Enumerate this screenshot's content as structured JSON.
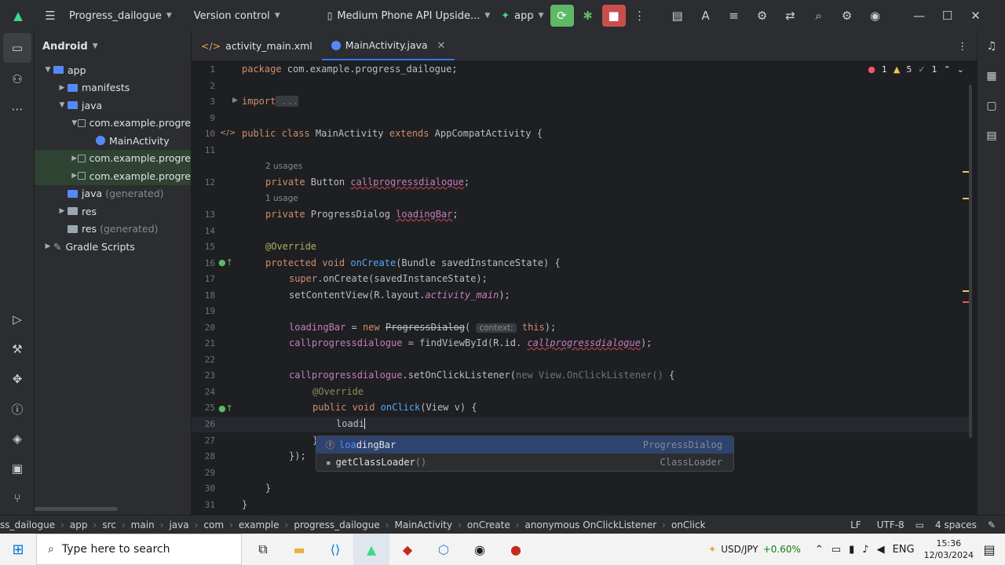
{
  "titlebar": {
    "project": "Progress_dailogue",
    "vcs": "Version control",
    "device": "Medium Phone API Upside...",
    "run_config": "app"
  },
  "project_panel": {
    "view": "Android",
    "items": [
      {
        "label": "app",
        "extra": ""
      },
      {
        "label": "manifests",
        "extra": ""
      },
      {
        "label": "java",
        "extra": ""
      },
      {
        "label": "com.example.progre",
        "extra": ""
      },
      {
        "label": "MainActivity",
        "extra": ""
      },
      {
        "label": "com.example.progre",
        "extra": ""
      },
      {
        "label": "com.example.progre",
        "extra": ""
      },
      {
        "label": "java",
        "extra": "(generated)"
      },
      {
        "label": "res",
        "extra": ""
      },
      {
        "label": "res",
        "extra": "(generated)"
      },
      {
        "label": "Gradle Scripts",
        "extra": ""
      }
    ]
  },
  "tabs": [
    {
      "label": "activity_main.xml"
    },
    {
      "label": "MainActivity.java"
    }
  ],
  "inspections": {
    "errors": "1",
    "warnings": "5",
    "ok": "1"
  },
  "editor": {
    "line_numbers": [
      "1",
      "2",
      "3",
      "9",
      "10",
      "11",
      "12",
      "13",
      "14",
      "15",
      "16",
      "17",
      "18",
      "19",
      "20",
      "21",
      "22",
      "23",
      "24",
      "25",
      "26",
      "27",
      "28",
      "29",
      "30",
      "31"
    ],
    "l1_kw": "package",
    "l1_rest": " com.example.progress_dailogue;",
    "l3_kw": "import",
    "l3_rest": " ...",
    "l10_a": "public class",
    "l10_b": " MainActivity ",
    "l10_c": "extends",
    "l10_d": " AppCompatActivity {",
    "hint_2_usages": "2 usages",
    "l12_a": "private",
    "l12_b": " Button ",
    "l12_c": "callprogressdialogue",
    "l12_d": ";",
    "hint_1_usage": "1 usage",
    "l13_a": "private",
    "l13_b": " ProgressDialog ",
    "l13_c": "loadingBar",
    "l13_d": ";",
    "l15": "@Override",
    "l16_a": "protected void",
    "l16_b": " onCreate",
    "l16_c": "(Bundle savedInstanceState) {",
    "l17_a": "super",
    "l17_b": ".onCreate(savedInstanceState);",
    "l18_a": "setContentView(R.layout.",
    "l18_b": "activity_main",
    "l18_c": ");",
    "l20_a": "loadingBar",
    "l20_b": " = ",
    "l20_c": "new",
    "l20_d": "ProgressDialog",
    "l20_e": "(",
    "l20_f": "context:",
    "l20_g": "this",
    "l20_h": ");",
    "l21_a": "callprogressdialogue",
    "l21_b": " = findViewById(R.id.",
    "l21_c": "callprogressdialogue",
    "l21_d": ");",
    "l23_a": "callprogressdialogue",
    "l23_b": ".setOnClickListener(",
    "l23_c": "new View.OnClickListener()",
    "l23_d": " {",
    "l24": "@Override",
    "l25_a": "public void",
    "l25_b": " onClick",
    "l25_c": "(View v) {",
    "l26": "loadi",
    "l27": "}",
    "l28": "});",
    "l30": "}",
    "l31": "}"
  },
  "completion": [
    {
      "match": "loa",
      "rest": "dingBar",
      "params": "",
      "type": "ProgressDialog"
    },
    {
      "match": "",
      "rest": "getClassLoader",
      "params": "()",
      "type": "ClassLoader"
    }
  ],
  "breadcrumb": [
    "ss_dailogue",
    "app",
    "src",
    "main",
    "java",
    "com",
    "example",
    "progress_dailogue",
    "MainActivity",
    "onCreate",
    "anonymous OnClickListener",
    "onClick"
  ],
  "status": {
    "line_sep": "LF",
    "encoding": "UTF-8",
    "indent": "4 spaces"
  },
  "taskbar": {
    "search_placeholder": "Type here to search",
    "ticker": "USD/JPY",
    "ticker_change": "+0.60%",
    "time": "15:36",
    "date": "12/03/2024"
  },
  "colors": {
    "accent": "#3574f0",
    "selection": "#2e436e",
    "keyword": "#cf8e6d",
    "field": "#c77dbb"
  }
}
